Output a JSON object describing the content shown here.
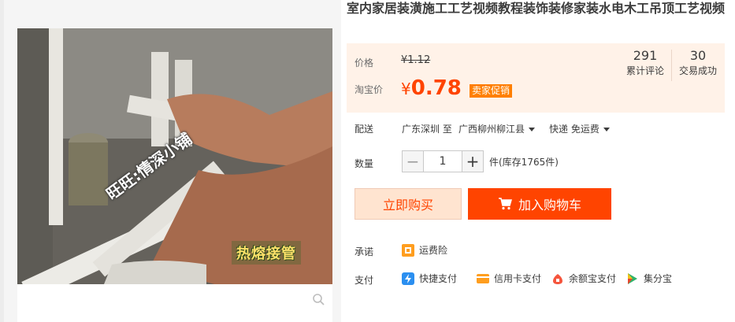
{
  "product": {
    "title": "室内家居装潢施工工艺视频教程装饰装修家装水电木工吊顶工艺视频",
    "photo_watermark": "旺旺:情深小铺",
    "photo_caption": "热熔接管"
  },
  "price": {
    "label": "价格",
    "original": "¥1.12",
    "taobao_label": "淘宝价",
    "currency": "¥",
    "current": "0.78",
    "promo_badge": "卖家促销"
  },
  "stats": [
    {
      "value": "291",
      "label": "累计评论"
    },
    {
      "value": "30",
      "label": "交易成功"
    }
  ],
  "delivery": {
    "label": "配送",
    "from": "广东深圳 至",
    "to": "广西柳州柳江县",
    "method": "快递 免运费"
  },
  "quantity": {
    "label": "数量",
    "value": "1",
    "stock": "件(库存1765件)",
    "minus": "−",
    "plus": "+"
  },
  "actions": {
    "buy_now": "立即购买",
    "add_to_cart": "加入购物车"
  },
  "promise": {
    "label": "承诺",
    "item": "运费险"
  },
  "payment": {
    "label": "支付",
    "methods": [
      "快捷支付",
      "信用卡支付",
      "余额宝支付",
      "集分宝"
    ]
  },
  "colors": {
    "accent": "#ff4400",
    "price_box_bg": "#fff2e8",
    "promo": "#ff7f00"
  },
  "icons": [
    "search-zoom-icon",
    "cart-icon",
    "caret-down-icon",
    "shield-icon",
    "quickpay-icon",
    "credit-card-icon",
    "yuebao-icon",
    "jifenbao-icon"
  ]
}
